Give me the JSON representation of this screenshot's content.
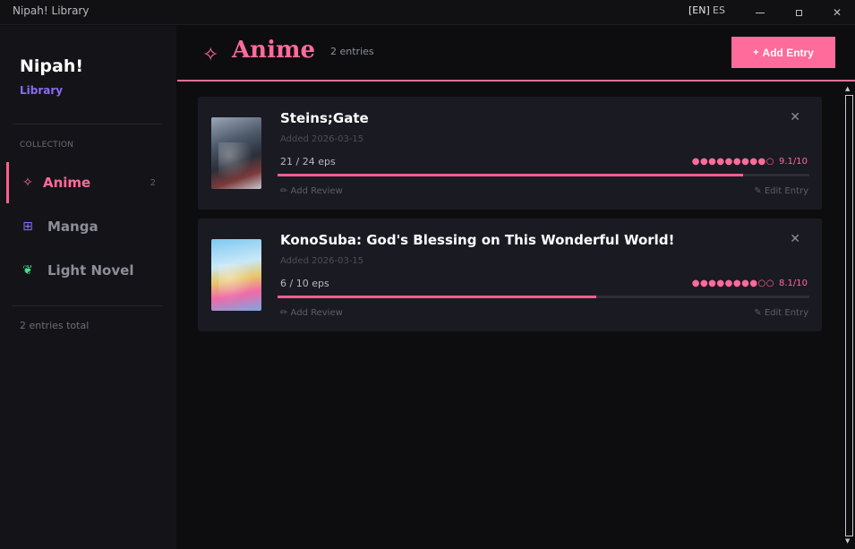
{
  "window": {
    "title": "Nipah! Library",
    "lang_en": "[EN]",
    "lang_es": "ES"
  },
  "sidebar": {
    "brand_title": "Nipah!",
    "brand_sub": "Library",
    "section_label": "COLLECTION",
    "items": [
      {
        "icon": "✧",
        "label": "Anime",
        "count": "2",
        "icon_color": "#ff6b9a"
      },
      {
        "icon": "⊞",
        "label": "Manga",
        "count": "",
        "icon_color": "#8a6cf0"
      },
      {
        "icon": "❦",
        "label": "Light Novel",
        "count": "",
        "icon_color": "#3ee08a"
      }
    ],
    "total": "2 entries total"
  },
  "header": {
    "icon": "✧",
    "title": "Anime",
    "count": "2 entries",
    "add_icon": "+",
    "add_label": "Add Entry"
  },
  "entries": [
    {
      "title": "Steins;Gate",
      "added": "Added 2026-03-15",
      "eps": "21 / 24 eps",
      "progress": 0.875,
      "rating_dots": "●●●●●●●●●○",
      "rating": "9.1/10",
      "review_label": "✏ Add Review",
      "edit_label": "✎ Edit Entry",
      "close": "✕"
    },
    {
      "title": "KonoSuba: God's Blessing on This Wonderful World!",
      "added": "Added 2026-03-15",
      "eps": "6 / 10 eps",
      "progress": 0.6,
      "rating_dots": "●●●●●●●●○○",
      "rating": "8.1/10",
      "review_label": "✏ Add Review",
      "edit_label": "✎ Edit Entry",
      "close": "✕"
    }
  ],
  "colors": {
    "accent": "#ff6b9a",
    "brand_sub": "#8a6cf0",
    "background": "#0d0d10",
    "sidebar": "#141418",
    "card": "#1a1a22"
  }
}
